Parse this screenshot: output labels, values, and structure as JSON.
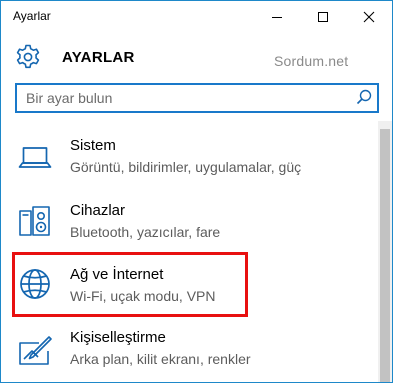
{
  "window": {
    "title": "Ayarlar",
    "controls": {
      "minimize": "minimize-icon",
      "maximize": "maximize-icon",
      "close": "close-icon"
    }
  },
  "header": {
    "icon": "gear-icon",
    "title": "AYARLAR",
    "watermark": "Sordum.net"
  },
  "search": {
    "placeholder": "Bir ayar bulun",
    "icon": "search-icon"
  },
  "categories": [
    {
      "label": "Sistem",
      "description": "Görüntü, bildirimler, uygulamalar, güç",
      "icon": "laptop-icon"
    },
    {
      "label": "Cihazlar",
      "description": "Bluetooth, yazıcılar, fare",
      "icon": "devices-icon"
    },
    {
      "label": "Ağ ve İnternet",
      "description": "Wi-Fi, uçak modu, VPN",
      "icon": "globe-icon",
      "highlighted": true
    },
    {
      "label": "Kişiselleştirme",
      "description": "Arka plan, kilit ekranı, renkler",
      "icon": "personalization-icon"
    }
  ],
  "colors": {
    "accent": "#1979ca",
    "window_border": "#1e88c9",
    "highlight_border": "#e81010",
    "icon_color": "#1466b0"
  }
}
